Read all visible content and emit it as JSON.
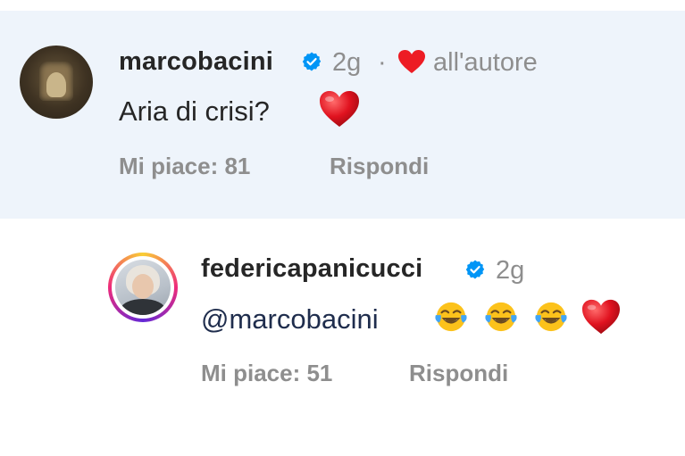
{
  "comments": [
    {
      "username": "marcobacini",
      "time": "2g",
      "separator": "·",
      "liked_by_author": "all'autore",
      "text": "Aria di crisi?",
      "likes": "Mi piace: 81",
      "reply": "Rispondi",
      "emoji": [
        "red-heart"
      ]
    },
    {
      "username": "federicapanicucci",
      "time": "2g",
      "text": "@marcobacini",
      "likes": "Mi piace: 51",
      "reply": "Rispondi",
      "emoji": [
        "face-with-tears-of-joy",
        "face-with-tears-of-joy",
        "face-with-tears-of-joy",
        "red-heart"
      ]
    }
  ],
  "colors": {
    "highlight_bg": "#eef4fb",
    "verified_blue": "#0095f6",
    "heart_red": "#ed1c24",
    "text_primary": "#262626",
    "text_secondary": "#8e8e8e"
  }
}
